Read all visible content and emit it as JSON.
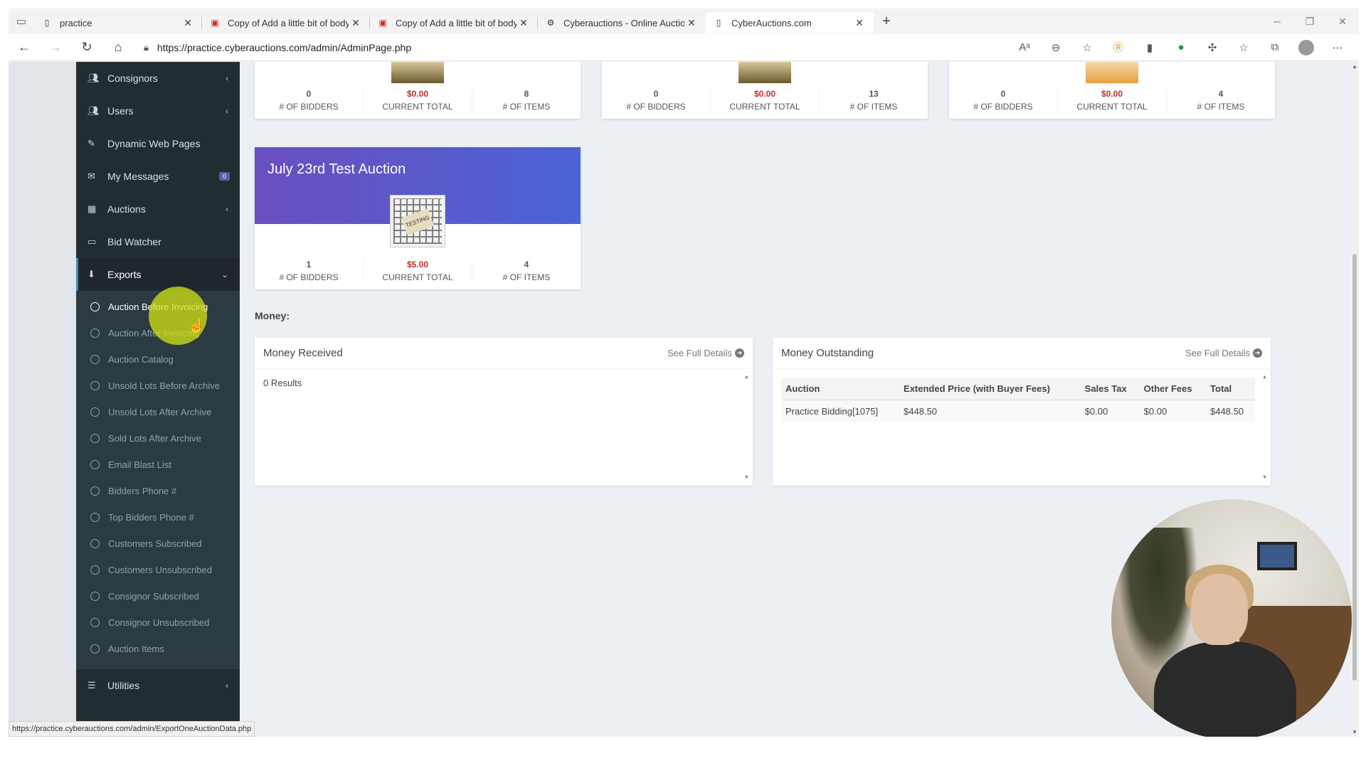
{
  "browser": {
    "tabs": [
      {
        "label": "practice",
        "icon": "page-icon"
      },
      {
        "label": "Copy of Add a little bit of body",
        "icon": "pdf-icon"
      },
      {
        "label": "Copy of Add a little bit of body",
        "icon": "pdf-icon"
      },
      {
        "label": "Cyberauctions - Online Auctions",
        "icon": "gear-icon"
      },
      {
        "label": "CyberAuctions.com",
        "icon": "page-icon",
        "active": true
      }
    ],
    "url": "https://practice.cyberauctions.com/admin/AdminPage.php",
    "status_url": "https://practice.cyberauctions.com/admin/ExportOneAuctionData.php"
  },
  "sidebar": {
    "items": [
      {
        "label": "Consignors",
        "icon": "users-icon"
      },
      {
        "label": "Users",
        "icon": "users-icon"
      },
      {
        "label": "Dynamic Web Pages",
        "icon": "wrench-icon"
      },
      {
        "label": "My Messages",
        "icon": "envelope-icon",
        "count": "0"
      },
      {
        "label": "Auctions",
        "icon": "calendar-icon"
      },
      {
        "label": "Bid Watcher",
        "icon": "monitor-icon"
      },
      {
        "label": "Exports",
        "icon": "download-icon"
      }
    ],
    "exports_submenu": [
      "Auction Before Invoicing",
      "Auction After Invoicing",
      "Auction Catalog",
      "Unsold Lots Before Archive",
      "Unsold Lots After Archive",
      "Sold Lots After Archive",
      "Email Blast List",
      "Bidders Phone #",
      "Top Bidders Phone #",
      "Customers Subscribed",
      "Customers Unsubscribed",
      "Consignor Subscribed",
      "Consignor Unsubscribed",
      "Auction Items"
    ],
    "utilities": "Utilities"
  },
  "auctions": [
    {
      "bidders": "0",
      "total": "$0.00",
      "items": "8"
    },
    {
      "bidders": "0",
      "total": "$0.00",
      "items": "13"
    },
    {
      "bidders": "0",
      "total": "$0.00",
      "items": "4"
    },
    {
      "title": "July 23rd Test Auction",
      "bidders": "1",
      "total": "$5.00",
      "items": "4",
      "photo_text": "TESTING"
    }
  ],
  "stat_labels": {
    "bidders": "# OF BIDDERS",
    "total": "CURRENT TOTAL",
    "items": "# OF ITEMS"
  },
  "money": {
    "section_label": "Money:",
    "received": {
      "title": "Money Received",
      "link": "See Full Details",
      "empty": "0 Results"
    },
    "outstanding": {
      "title": "Money Outstanding",
      "link": "See Full Details",
      "columns": [
        "Auction",
        "Extended Price (with Buyer Fees)",
        "Sales Tax",
        "Other Fees",
        "Total"
      ],
      "rows": [
        [
          "Practice Bidding[1075]",
          "$448.50",
          "$0.00",
          "$0.00",
          "$448.50"
        ]
      ]
    }
  },
  "colors": {
    "sidebar": "#222d32",
    "card_header": "#5a5bd0",
    "money_red": "#c12e2a"
  }
}
